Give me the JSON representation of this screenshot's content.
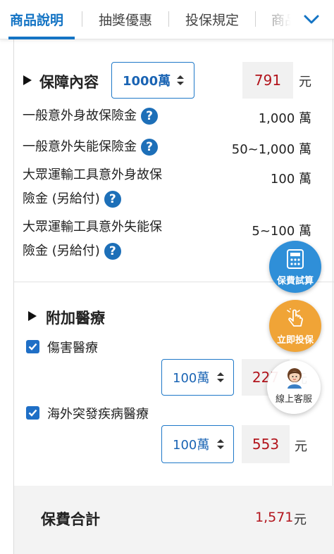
{
  "tabs": [
    {
      "label": "商品說明",
      "active": true
    },
    {
      "label": "抽獎優惠",
      "active": false
    },
    {
      "label": "投保規定",
      "active": false
    },
    {
      "label": "商品",
      "active": false
    }
  ],
  "coverage": {
    "heading": "保障內容",
    "amount_select": "1000萬",
    "premium": "791",
    "unit": "元",
    "rows": [
      {
        "label_line1": "一般意外身故保險金",
        "label_line2": "",
        "value": "1,000 萬"
      },
      {
        "label_line1": "一般意外失能保險金",
        "label_line2": "",
        "value": "50~1,000 萬"
      },
      {
        "label_line1": "大眾運輸工具意外身故保",
        "label_line2": "險金 (另給付)",
        "value": "100 萬"
      },
      {
        "label_line1": "大眾運輸工具意外失能保",
        "label_line2": "險金 (另給付)",
        "value": "5~100 萬"
      }
    ]
  },
  "medical": {
    "heading": "附加醫療",
    "items": [
      {
        "label": "傷害醫療",
        "checked": true,
        "amount_select": "100萬",
        "premium": "227",
        "unit": "元"
      },
      {
        "label": "海外突發疾病醫療",
        "checked": true,
        "amount_select": "100萬",
        "premium": "553",
        "unit": "元"
      }
    ]
  },
  "total": {
    "label": "保費合計",
    "value": "1,571",
    "unit": "元"
  },
  "floating": {
    "quote": {
      "label": "保費試算",
      "color": "#2f8fd8",
      "icon": "calculator-icon"
    },
    "apply": {
      "label": "立即投保",
      "color": "#f0a437",
      "icon": "tap-hand-icon"
    },
    "service": {
      "label": "線上客服",
      "icon": "agent-avatar-icon"
    }
  },
  "colors": {
    "accent": "#1474c4",
    "premium_red": "#b2141c"
  }
}
